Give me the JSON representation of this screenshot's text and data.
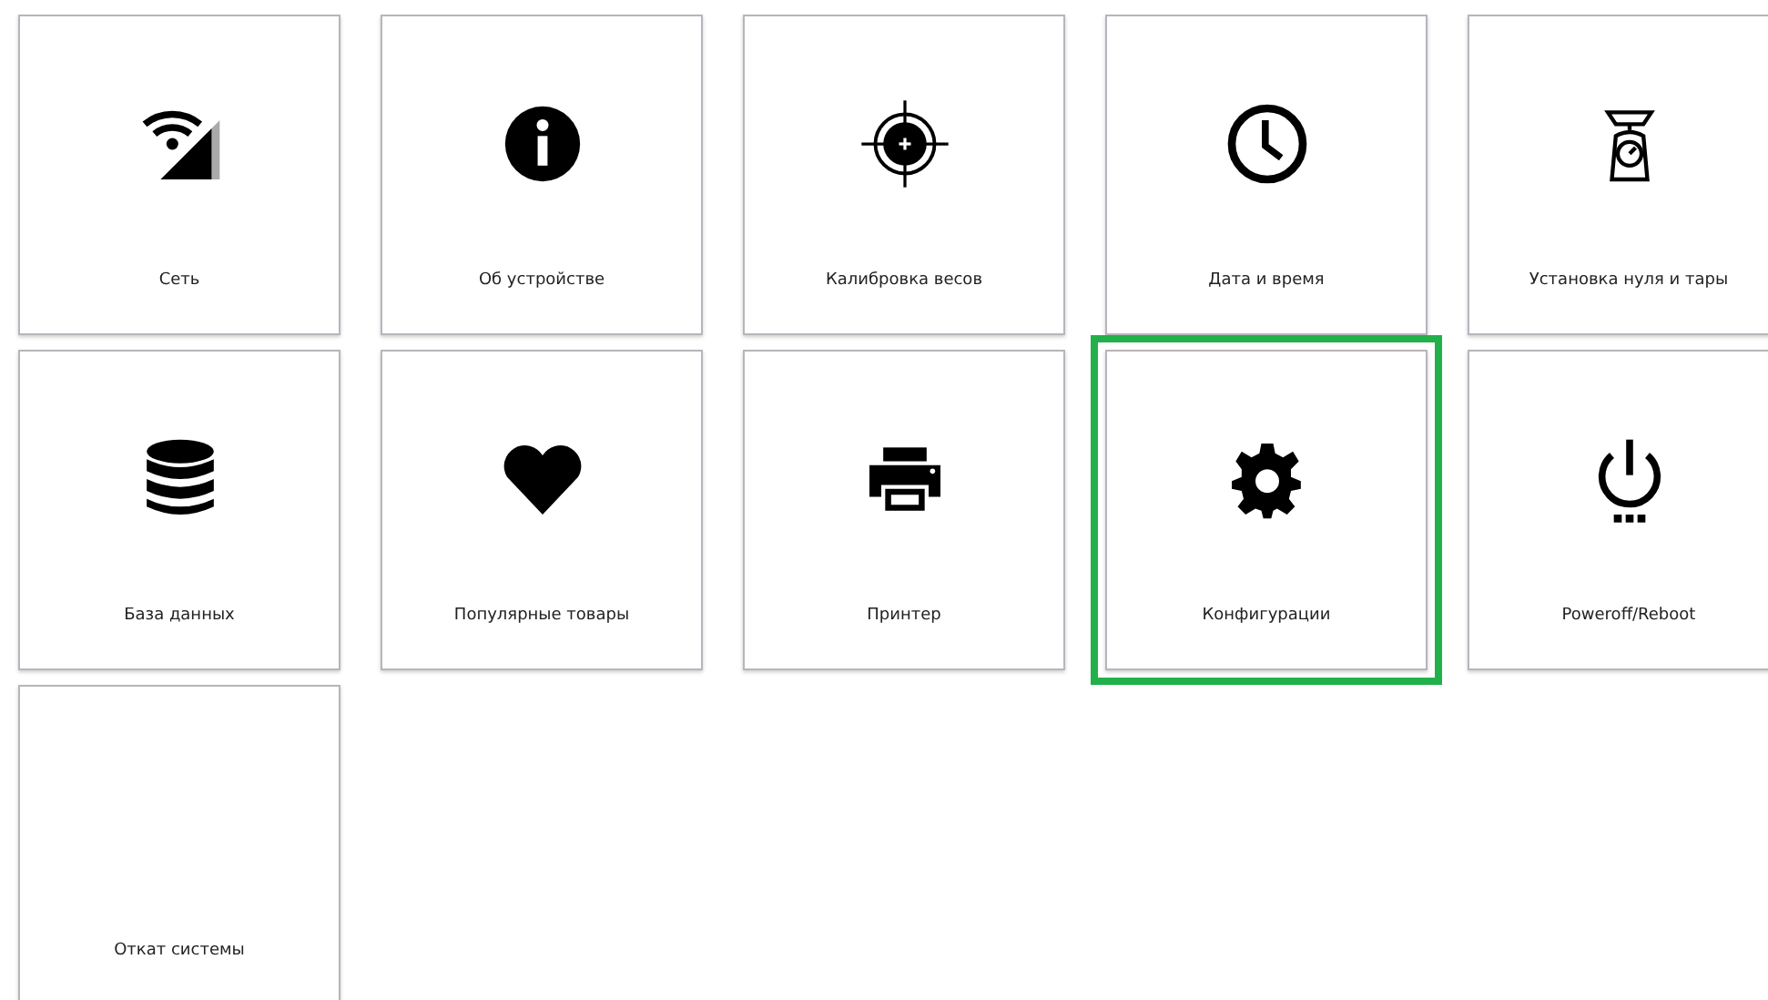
{
  "tiles": [
    {
      "label": "Сеть",
      "selected": false
    },
    {
      "label": "Об устройстве",
      "selected": false
    },
    {
      "label": "Калибровка весов",
      "selected": false
    },
    {
      "label": "Дата и время",
      "selected": false
    },
    {
      "label": "Установка нуля и тары",
      "selected": false
    },
    {
      "label": "База данных",
      "selected": false
    },
    {
      "label": "Популярные товары",
      "selected": false
    },
    {
      "label": "Принтер",
      "selected": false
    },
    {
      "label": "Конфигурации",
      "selected": true
    },
    {
      "label": "Poweroff/Reboot",
      "selected": false
    },
    {
      "label": "Откат системы",
      "selected": false
    }
  ]
}
